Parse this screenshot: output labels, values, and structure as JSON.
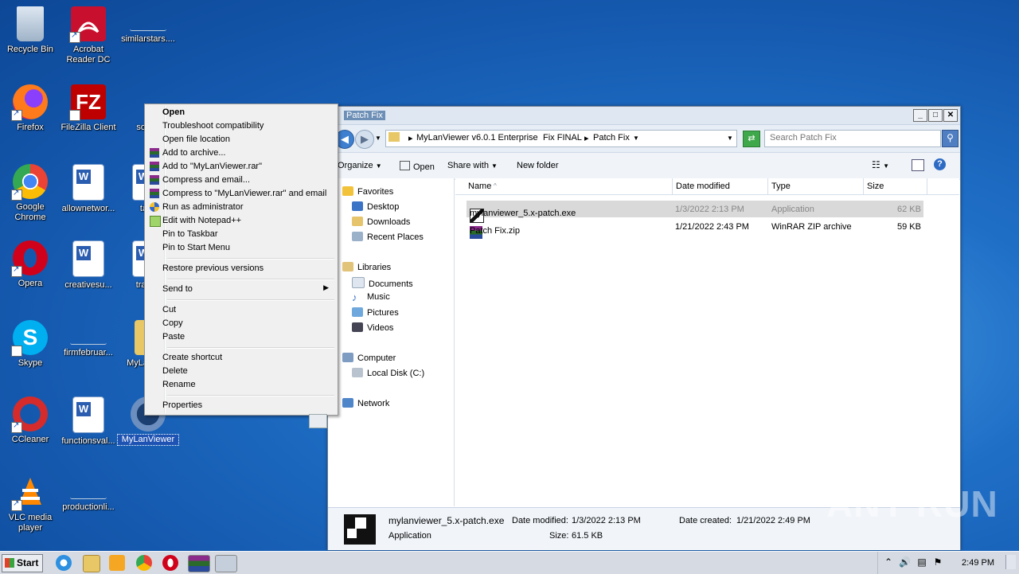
{
  "desktop": {
    "icons": [
      {
        "label": "Recycle Bin"
      },
      {
        "label": "Acrobat Reader DC"
      },
      {
        "label": "similarstars...."
      },
      {
        "label": "Firefox"
      },
      {
        "label": "FileZilla Client"
      },
      {
        "label": "sonyn"
      },
      {
        "label": "Google Chrome"
      },
      {
        "label": "allownetwor..."
      },
      {
        "label": "taxs"
      },
      {
        "label": "Opera"
      },
      {
        "label": "creativesu..."
      },
      {
        "label": "transp"
      },
      {
        "label": "Skype"
      },
      {
        "label": "firmfebruar..."
      },
      {
        "label": "MyLa v6.0."
      },
      {
        "label": "CCleaner"
      },
      {
        "label": "functionsval..."
      },
      {
        "label": "MyLanViewer"
      },
      {
        "label": "VLC media player"
      },
      {
        "label": "productionli..."
      }
    ]
  },
  "context_menu": {
    "items": [
      {
        "label": "Open"
      },
      {
        "label": "Troubleshoot compatibility"
      },
      {
        "label": "Open file location"
      },
      {
        "label": "Add to archive..."
      },
      {
        "label": "Add to \"MyLanViewer.rar\""
      },
      {
        "label": "Compress and email..."
      },
      {
        "label": "Compress to \"MyLanViewer.rar\" and email"
      },
      {
        "label": "Run as administrator"
      },
      {
        "label": "Edit with Notepad++"
      },
      {
        "label": "Pin to Taskbar"
      },
      {
        "label": "Pin to Start Menu"
      },
      {
        "label": "Restore previous versions"
      },
      {
        "label": "Send to"
      },
      {
        "label": "Cut"
      },
      {
        "label": "Copy"
      },
      {
        "label": "Paste"
      },
      {
        "label": "Create shortcut"
      },
      {
        "label": "Delete"
      },
      {
        "label": "Rename"
      },
      {
        "label": "Properties"
      }
    ]
  },
  "explorer": {
    "title": "Patch Fix",
    "breadcrumb": [
      "MyLanViewer v6.0.1 Enterprise",
      "Fix FINAL",
      "Patch Fix"
    ],
    "search_placeholder": "Search Patch Fix",
    "toolbar": {
      "organize": "Organize",
      "open": "Open",
      "share_with": "Share with",
      "new_folder": "New folder"
    },
    "nav": {
      "favorites": "Favorites",
      "favorites_items": [
        "Desktop",
        "Downloads",
        "Recent Places"
      ],
      "libraries": "Libraries",
      "libraries_items": [
        "Documents",
        "Music",
        "Pictures",
        "Videos"
      ],
      "computer": "Computer",
      "computer_items": [
        "Local Disk (C:)"
      ],
      "network": "Network"
    },
    "columns": [
      "Name",
      "Date modified",
      "Type",
      "Size"
    ],
    "files": [
      {
        "name": "mylanviewer_5.x-patch.exe",
        "date": "1/3/2022 2:13 PM",
        "type": "Application",
        "size": "62 KB"
      },
      {
        "name": "Patch Fix.zip",
        "date": "1/21/2022 2:43 PM",
        "type": "WinRAR ZIP archive",
        "size": "59 KB"
      }
    ],
    "details": {
      "filename": "mylanviewer_5.x-patch.exe",
      "type": "Application",
      "modified_label": "Date modified:",
      "modified": "1/3/2022 2:13 PM",
      "size_label": "Size:",
      "size": "61.5 KB",
      "created_label": "Date created:",
      "created": "1/21/2022 2:49 PM"
    }
  },
  "taskbar": {
    "start": "Start",
    "clock": "2:49 PM"
  },
  "watermark": "ANY RUN"
}
